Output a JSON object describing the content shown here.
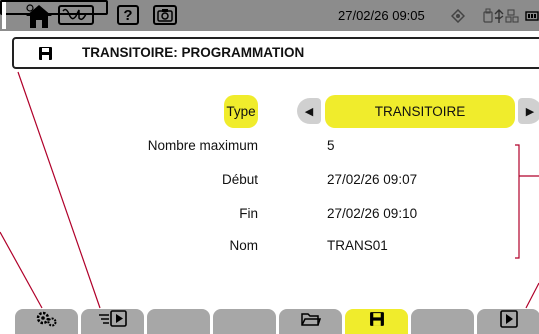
{
  "status_bar": {
    "datetime": "27/02/26 09:05",
    "help_glyph": "?",
    "icons": [
      "home-icon",
      "waveform-mode-icon",
      "help-icon",
      "camera-icon",
      "gps-icon",
      "usb-ethernet-icon",
      "battery-icon"
    ],
    "memory_fill_fraction": 0.04
  },
  "header": {
    "title": "TRANSITOIRE: PROGRAMMATION",
    "icon": "save-icon"
  },
  "form": {
    "type_label": "Type",
    "type_value": "TRANSITOIRE",
    "rows": [
      {
        "label": "Nombre maximum",
        "value": "5"
      },
      {
        "label": "Début",
        "value": "27/02/26 09:07"
      },
      {
        "label": "Fin",
        "value": "27/02/26 09:10"
      },
      {
        "label": "Nom",
        "value": "TRANS01"
      }
    ]
  },
  "softkeys": [
    {
      "icon": "settings-icon",
      "active": false
    },
    {
      "icon": "start-list-icon",
      "active": false
    },
    {
      "icon": "",
      "active": false
    },
    {
      "icon": "",
      "active": false
    },
    {
      "icon": "folder-icon",
      "active": false
    },
    {
      "icon": "save-icon",
      "active": true
    },
    {
      "icon": "",
      "active": false
    },
    {
      "icon": "play-icon",
      "active": false
    }
  ],
  "colors": {
    "status_bar": "#8c8c8c",
    "highlight": "#f0ec2c",
    "softkey": "#a7a7a7",
    "annotation_line": "#b0002a"
  }
}
